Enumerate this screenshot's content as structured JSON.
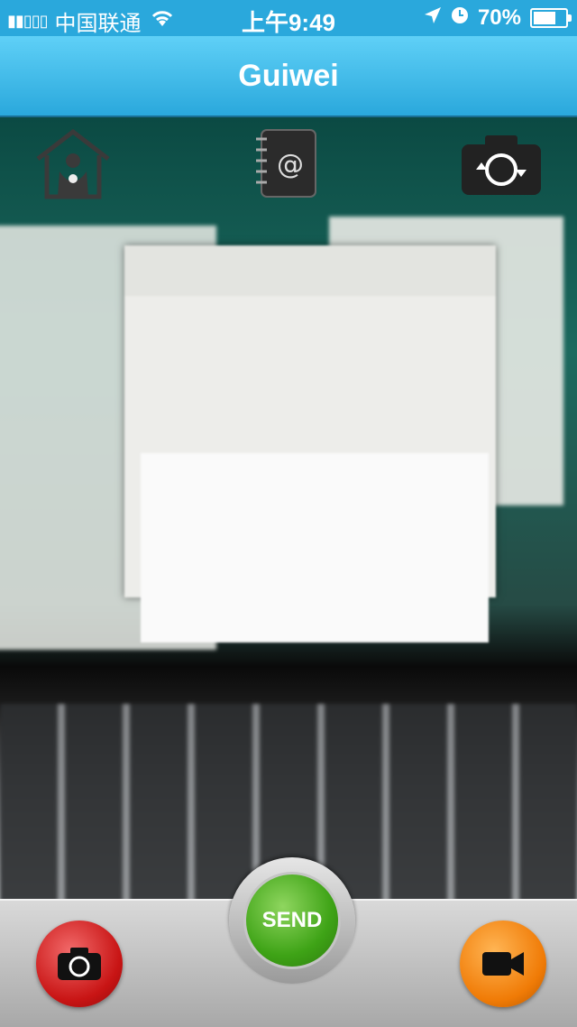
{
  "status_bar": {
    "carrier": "中国联通",
    "time": "上午9:49",
    "battery": "70%",
    "battery_level": 0.7,
    "icons": [
      "signal-icon",
      "wifi-icon",
      "location-icon",
      "clock-icon",
      "battery-icon"
    ]
  },
  "header": {
    "title": "Guiwei"
  },
  "toolbar": {
    "home_icon": "home-icon",
    "contacts_icon": "address-book-icon",
    "flip_icon": "camera-flip-icon"
  },
  "bottom_bar": {
    "send_label": "SEND",
    "photo_icon": "camera-icon",
    "video_icon": "video-camera-icon"
  },
  "colors": {
    "accent": "#2aa8dc",
    "send": "#3ea316",
    "photo": "#c81414",
    "video": "#f07b06"
  }
}
